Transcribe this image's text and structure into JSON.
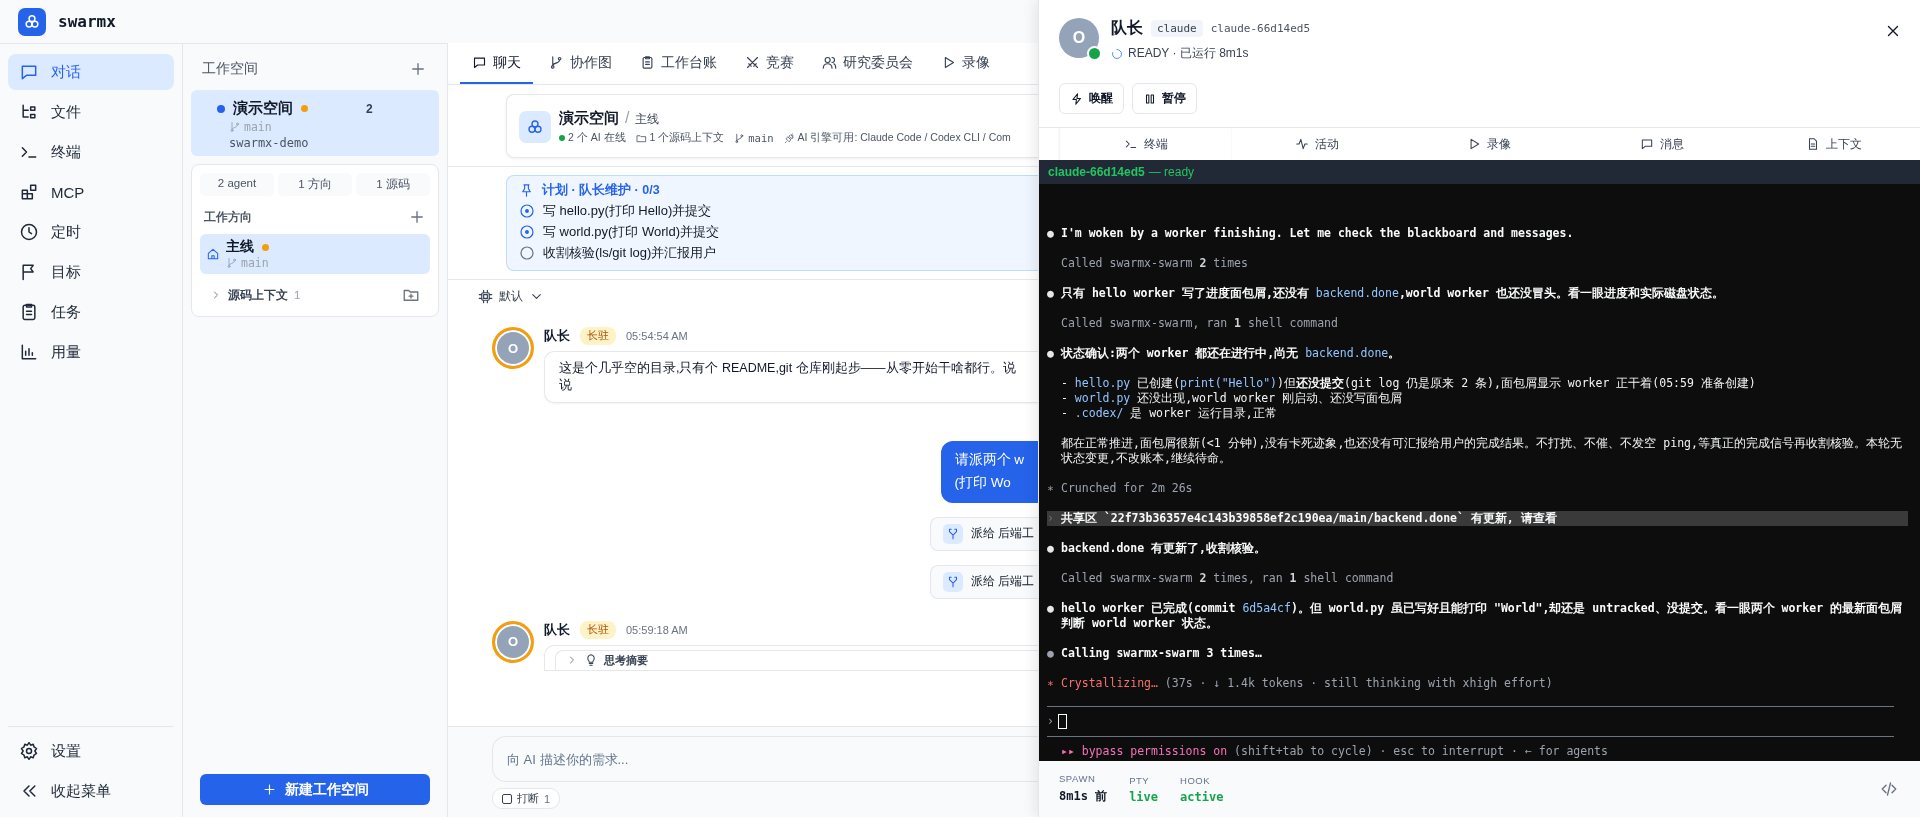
{
  "app": {
    "name": "swarmx"
  },
  "nav": {
    "items": [
      {
        "kind": "chat",
        "label": "对话",
        "selected": true
      },
      {
        "kind": "files",
        "label": "文件",
        "selected": false
      },
      {
        "kind": "terminal",
        "label": "终端",
        "selected": false
      },
      {
        "kind": "mcp",
        "label": "MCP",
        "selected": false
      },
      {
        "kind": "clock",
        "label": "定时",
        "selected": false
      },
      {
        "kind": "flag",
        "label": "目标",
        "selected": false
      },
      {
        "kind": "tasks",
        "label": "任务",
        "selected": false
      },
      {
        "kind": "usage",
        "label": "用量",
        "selected": false
      }
    ],
    "footer": [
      {
        "kind": "gear",
        "label": "设置"
      },
      {
        "kind": "collapse",
        "label": "收起菜单"
      }
    ]
  },
  "workspaces": {
    "title": "工作空间",
    "items": [
      {
        "name": "演示空间",
        "branch": "main",
        "path": "swarmx-demo",
        "count": "2",
        "selected": true,
        "busy": true
      }
    ],
    "stats": [
      "2 agent",
      "1 方向",
      "1 源码"
    ],
    "directions_title": "工作方向",
    "directions": [
      {
        "name": "主线",
        "branch": "main",
        "selected": true,
        "busy": true
      }
    ],
    "source": {
      "label": "源码上下文",
      "count": "1",
      "expanded": false
    },
    "new_button": "新建工作空间"
  },
  "main": {
    "tabs": [
      {
        "kind": "chat",
        "label": "聊天",
        "selected": true
      },
      {
        "kind": "graph",
        "label": "协作图",
        "selected": false
      },
      {
        "kind": "ledger",
        "label": "工作台账",
        "selected": false
      },
      {
        "kind": "contest",
        "label": "竞赛",
        "selected": false
      },
      {
        "kind": "committee",
        "label": "研究委员会",
        "selected": false
      },
      {
        "kind": "record",
        "label": "录像",
        "selected": false
      }
    ],
    "header": {
      "title": "演示空间",
      "separator": "/",
      "subtitle": "主线",
      "meta": [
        {
          "kind": "online",
          "text": "2 个 AI 在线"
        },
        {
          "kind": "folder",
          "text": "1 个源码上下文"
        },
        {
          "kind": "branch",
          "text": "main"
        },
        {
          "kind": "engine",
          "text": "AI 引擎可用: Claude Code / Codex CLI / Com"
        }
      ]
    },
    "plan": {
      "title": "计划 · 队长维护 · 0/3",
      "items": [
        {
          "kind": "active",
          "text": "写 hello.py(打印 Hello)并提交"
        },
        {
          "kind": "active",
          "text": "写 world.py(打印 World)并提交"
        },
        {
          "kind": "pending",
          "text": "收割核验(ls/git log)并汇报用户"
        }
      ]
    },
    "model": "默认",
    "messages": [
      {
        "kind": "agent",
        "avatar": "O",
        "name": "队长",
        "badge": "长驻",
        "time": "05:54:54 AM",
        "text": "这是个几乎空的目录,只有个 README,git 仓库刚起步——从零开始干啥都行。说说"
      },
      {
        "kind": "user",
        "text": "请派两个 w\n(打印 Wo"
      },
      {
        "kind": "dispatch",
        "text": "派给 后端工"
      },
      {
        "kind": "dispatch",
        "text": "派给 后端工"
      },
      {
        "kind": "agent",
        "avatar": "O",
        "name": "队长",
        "badge": "长驻",
        "time": "05:59:18 AM",
        "thinking": {
          "label": "思考摘要",
          "expanded": false
        }
      }
    ],
    "input": {
      "placeholder": "向 AI 描述你的需求..."
    },
    "interrupt": {
      "label": "打断",
      "count": "1",
      "checked": false
    }
  },
  "drawer": {
    "agent": {
      "avatar": "O",
      "name": "队长",
      "runtime": "claude",
      "id": "claude-66d14ed5",
      "status": "READY · 已运行 8m1s",
      "online": true
    },
    "buttons": [
      {
        "kind": "wake",
        "label": "唤醒"
      },
      {
        "kind": "pause",
        "label": "暂停"
      }
    ],
    "tabs": [
      {
        "kind": "terminal",
        "label": "终端",
        "selected": true
      },
      {
        "kind": "activity",
        "label": "活动",
        "selected": false
      },
      {
        "kind": "record",
        "label": "录像",
        "selected": false
      },
      {
        "kind": "message",
        "label": "消息",
        "selected": false
      },
      {
        "kind": "context",
        "label": "上下文",
        "selected": false
      }
    ],
    "terminal": {
      "title": "claude-66d14ed5",
      "state": "— ready",
      "lines": [
        {
          "kind": "bullet",
          "marker": "●",
          "parts": [
            {
              "kind": "bold",
              "text": "I'm woken by a worker finishing. Let me check the blackboard and messages."
            }
          ]
        },
        {
          "kind": "note",
          "parts": [
            {
              "kind": "dim",
              "text": "Called swarmx-swarm "
            },
            {
              "kind": "dimbold",
              "text": "2"
            },
            {
              "kind": "dim",
              "text": " times"
            }
          ]
        },
        {
          "kind": "bullet",
          "marker": "●",
          "parts": [
            {
              "kind": "bold",
              "text": "只有 hello worker 写了进度面包屑,还没有 "
            },
            {
              "kind": "code",
              "text": "backend.done"
            },
            {
              "kind": "bold",
              "text": ",world worker 也还没冒头。看一眼进度和实际磁盘状态。"
            }
          ]
        },
        {
          "kind": "note",
          "parts": [
            {
              "kind": "dim",
              "text": "Called swarmx-swarm, ran "
            },
            {
              "kind": "dimbold",
              "text": "1"
            },
            {
              "kind": "dim",
              "text": " shell command"
            }
          ]
        },
        {
          "kind": "bullet",
          "marker": "●",
          "parts": [
            {
              "kind": "bold",
              "text": "状态确认:两个 worker 都还在进行中,尚无 "
            },
            {
              "kind": "code",
              "text": "backend.done"
            },
            {
              "kind": "bold",
              "text": "。"
            }
          ]
        },
        {
          "kind": "list",
          "parts": [
            {
              "kind": "plain",
              "text": "- "
            },
            {
              "kind": "code",
              "text": "hello.py"
            },
            {
              "kind": "plain",
              "text": " 已创建("
            },
            {
              "kind": "code",
              "text": "print(\"Hello\")"
            },
            {
              "kind": "plain",
              "text": ")但"
            },
            {
              "kind": "bold",
              "text": "还没提交"
            },
            {
              "kind": "plain",
              "text": "(git log 仍是原来 2 条),面包屑显示 worker 正干着(05:59 准备创建)"
            }
          ]
        },
        {
          "kind": "list",
          "parts": [
            {
              "kind": "plain",
              "text": "- "
            },
            {
              "kind": "code",
              "text": "world.py"
            },
            {
              "kind": "plain",
              "text": " 还没出现,world worker 刚启动、还没写面包屑"
            }
          ]
        },
        {
          "kind": "list-end",
          "parts": [
            {
              "kind": "plain",
              "text": "- "
            },
            {
              "kind": "code",
              "text": ".codex/"
            },
            {
              "kind": "plain",
              "text": " 是 worker 运行目录,正常"
            }
          ]
        },
        {
          "kind": "note",
          "parts": [
            {
              "kind": "plain",
              "text": "都在正常推进,面包屑很新(<1 分钟),没有卡死迹象,也还没有可汇报给用户的完成结果。不打扰、不催、不发空 ping,等真正的完成信号再收割核验。本轮无状态变更,不改账本,继续待命。"
            }
          ]
        },
        {
          "kind": "status",
          "marker": "∗",
          "parts": [
            {
              "kind": "dim",
              "text": "Crunched for 2m 26s"
            }
          ]
        },
        {
          "kind": "shared",
          "marker": "›",
          "parts": [
            {
              "kind": "bold",
              "text": "共享区 `22f73b36357e4c143b39858ef2c190ea/main/backend.done` 有更新, 请查看"
            }
          ]
        },
        {
          "kind": "bullet",
          "marker": "●",
          "parts": [
            {
              "kind": "bold",
              "text": "backend.done 有更新了,收割核验。"
            }
          ]
        },
        {
          "kind": "note",
          "parts": [
            {
              "kind": "dim",
              "text": "Called swarmx-swarm "
            },
            {
              "kind": "dimbold",
              "text": "2"
            },
            {
              "kind": "dim",
              "text": " times, ran "
            },
            {
              "kind": "dimbold",
              "text": "1"
            },
            {
              "kind": "dim",
              "text": " shell command"
            }
          ]
        },
        {
          "kind": "bullet",
          "marker": "●",
          "parts": [
            {
              "kind": "bold",
              "text": "hello worker 已完成(commit "
            },
            {
              "kind": "code",
              "text": "6d5a4cf"
            },
            {
              "kind": "bold",
              "text": ")。但 world.py 虽已写好且能打印 \"World\",却还是 "
            },
            {
              "kind": "strong",
              "text": "untracked"
            },
            {
              "kind": "bold",
              "text": "、"
            },
            {
              "kind": "strong",
              "text": "没提交"
            },
            {
              "kind": "bold",
              "text": "。看一眼两个 worker 的最新面包屑判断 world worker 状态。"
            }
          ]
        },
        {
          "kind": "pending",
          "marker": "●",
          "parts": [
            {
              "kind": "bold",
              "text": "Calling swarmx-swarm "
            },
            {
              "kind": "strong",
              "text": "3"
            },
            {
              "kind": "bold",
              "text": " times…"
            }
          ]
        },
        {
          "kind": "working",
          "marker": "∗",
          "parts": [
            {
              "kind": "red",
              "text": "Crystallizing…"
            },
            {
              "kind": "dim",
              "text": " (37s · ↓ 1.4k tokens · still thinking with xhigh effort)"
            }
          ]
        }
      ],
      "prompt": "›",
      "hint": [
        {
          "kind": "pink",
          "text": "▸▸ bypass permissions on"
        },
        {
          "kind": "dim",
          "text": " (shift+tab to cycle) · esc to interrupt · ← for agents"
        }
      ]
    },
    "stats": [
      {
        "label": "SPAWN",
        "value": "8m1s 前",
        "kind": "plain"
      },
      {
        "label": "PTY",
        "value": "live",
        "kind": "ok"
      },
      {
        "label": "HOOK",
        "value": "active",
        "kind": "ok"
      }
    ]
  }
}
